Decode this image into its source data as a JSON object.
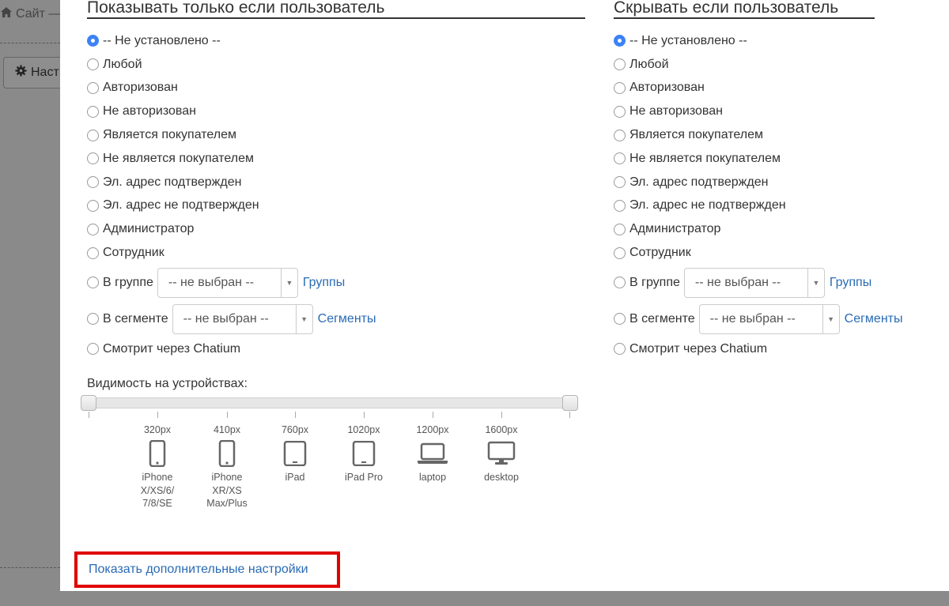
{
  "background": {
    "breadcrumb_site": "Сайт —",
    "settings_button": "Наст"
  },
  "left": {
    "title": "Показывать только если пользователь",
    "options": [
      "-- Не установлено --",
      "Любой",
      "Авторизован",
      "Не авторизован",
      "Является покупателем",
      "Не является покупателем",
      "Эл. адрес подтвержден",
      "Эл. адрес не подтвержден",
      "Администратор",
      "Сотрудник"
    ],
    "group_label": "В группе",
    "group_select": "-- не выбран --",
    "group_link": "Группы",
    "segment_label": "В сегменте",
    "segment_select": "-- не выбран --",
    "segment_link": "Сегменты",
    "chatium_label": "Смотрит через Chatium",
    "selected_index": 0
  },
  "right": {
    "title": "Скрывать если пользователь",
    "options": [
      "-- Не установлено --",
      "Любой",
      "Авторизован",
      "Не авторизован",
      "Является покупателем",
      "Не является покупателем",
      "Эл. адрес подтвержден",
      "Эл. адрес не подтвержден",
      "Администратор",
      "Сотрудник"
    ],
    "group_label": "В группе",
    "group_select": "-- не выбран --",
    "group_link": "Группы",
    "segment_label": "В сегменте",
    "segment_select": "-- не выбран --",
    "segment_link": "Сегменты",
    "chatium_label": "Смотрит через Chatium",
    "selected_index": 0
  },
  "visibility": {
    "label": "Видимость на устройствах:",
    "range_min_fraction": 0,
    "range_max_fraction": 1,
    "devices": [
      {
        "px": "320px",
        "name_lines": [
          "iPhone",
          "X/XS/6/",
          "7/8/SE"
        ],
        "icon": "phone-icon"
      },
      {
        "px": "410px",
        "name_lines": [
          "iPhone",
          "XR/XS",
          "Max/Plus"
        ],
        "icon": "phone-icon"
      },
      {
        "px": "760px",
        "name_lines": [
          "iPad"
        ],
        "icon": "tablet-icon"
      },
      {
        "px": "1020px",
        "name_lines": [
          "iPad Pro"
        ],
        "icon": "tablet-icon"
      },
      {
        "px": "1200px",
        "name_lines": [
          "laptop"
        ],
        "icon": "laptop-icon"
      },
      {
        "px": "1600px",
        "name_lines": [
          "desktop"
        ],
        "icon": "desktop-icon"
      }
    ]
  },
  "more_settings_link": "Показать дополнительные настройки",
  "colors": {
    "link": "#2a6bb5",
    "radio_checked": "#3b82f6",
    "highlight_box": "#e00000"
  }
}
